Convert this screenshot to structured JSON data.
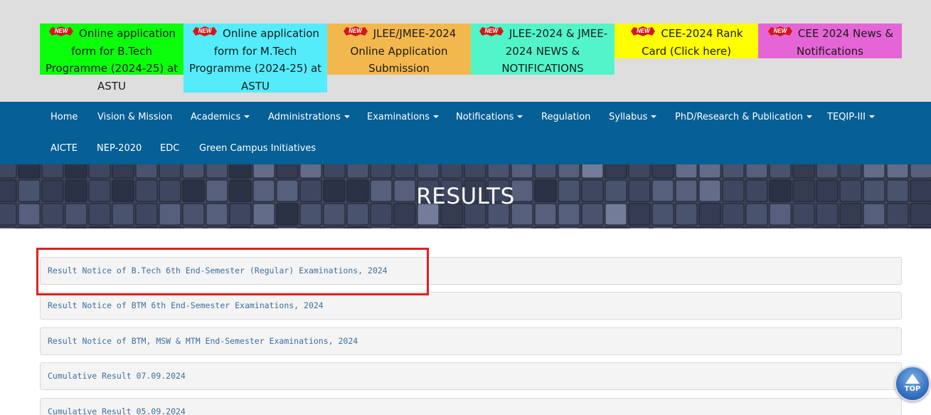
{
  "banners": [
    {
      "badge": "NEW",
      "text": "Online application form for B.Tech Programme (2024-25) at ASTU",
      "color": "#0bff0b"
    },
    {
      "badge": "NEW",
      "text": "Online application form for M.Tech Programme (2024-25) at ASTU",
      "color": "#54ecfb"
    },
    {
      "badge": "NEW",
      "text": "JLEE/JMEE-2024 Online Application Submission",
      "color": "#f3b84d"
    },
    {
      "badge": "NEW",
      "text": "JLEE-2024 & JMEE-2024 NEWS & NOTIFICATIONS",
      "color": "#52f5c9"
    },
    {
      "badge": "NEW",
      "text": "CEE-2024 Rank Card (Click here)",
      "color": "#ffff00"
    },
    {
      "badge": "NEW",
      "text": "CEE 2024 News & Notifications",
      "color": "#e565d6"
    }
  ],
  "nav": {
    "row1": [
      {
        "label": "Home",
        "dropdown": false
      },
      {
        "label": "Vision & Mission",
        "dropdown": false
      },
      {
        "label": "Academics",
        "dropdown": true
      },
      {
        "label": "Administrations",
        "dropdown": true
      },
      {
        "label": "Examinations",
        "dropdown": true
      },
      {
        "label": "Notifications",
        "dropdown": true
      },
      {
        "label": "Regulation",
        "dropdown": false
      },
      {
        "label": "Syllabus",
        "dropdown": true
      },
      {
        "label": "PhD/Research & Publication",
        "dropdown": true
      },
      {
        "label": "TEQIP-III",
        "dropdown": true
      }
    ],
    "row2": [
      {
        "label": "AICTE",
        "dropdown": false
      },
      {
        "label": "NEP-2020",
        "dropdown": false
      },
      {
        "label": "EDC",
        "dropdown": false
      },
      {
        "label": "Green Campus Initiatives",
        "dropdown": false
      }
    ]
  },
  "hero": {
    "title": "RESULTS"
  },
  "results": [
    "Result Notice of B.Tech 6th End-Semester (Regular) Examinations, 2024",
    "Result Notice of BTM 6th End-Semester Examinations, 2024",
    "Result Notice of BTM, MSW & MTM End-Semester Examinations, 2024",
    "Cumulative Result 07.09.2024",
    "Cumulative Result 05.09.2024"
  ],
  "back_to_top": {
    "label": "TOP"
  },
  "colors": {
    "nav_bg": "#065f95",
    "link": "#3d6f9e",
    "highlight": "#e0201f"
  }
}
